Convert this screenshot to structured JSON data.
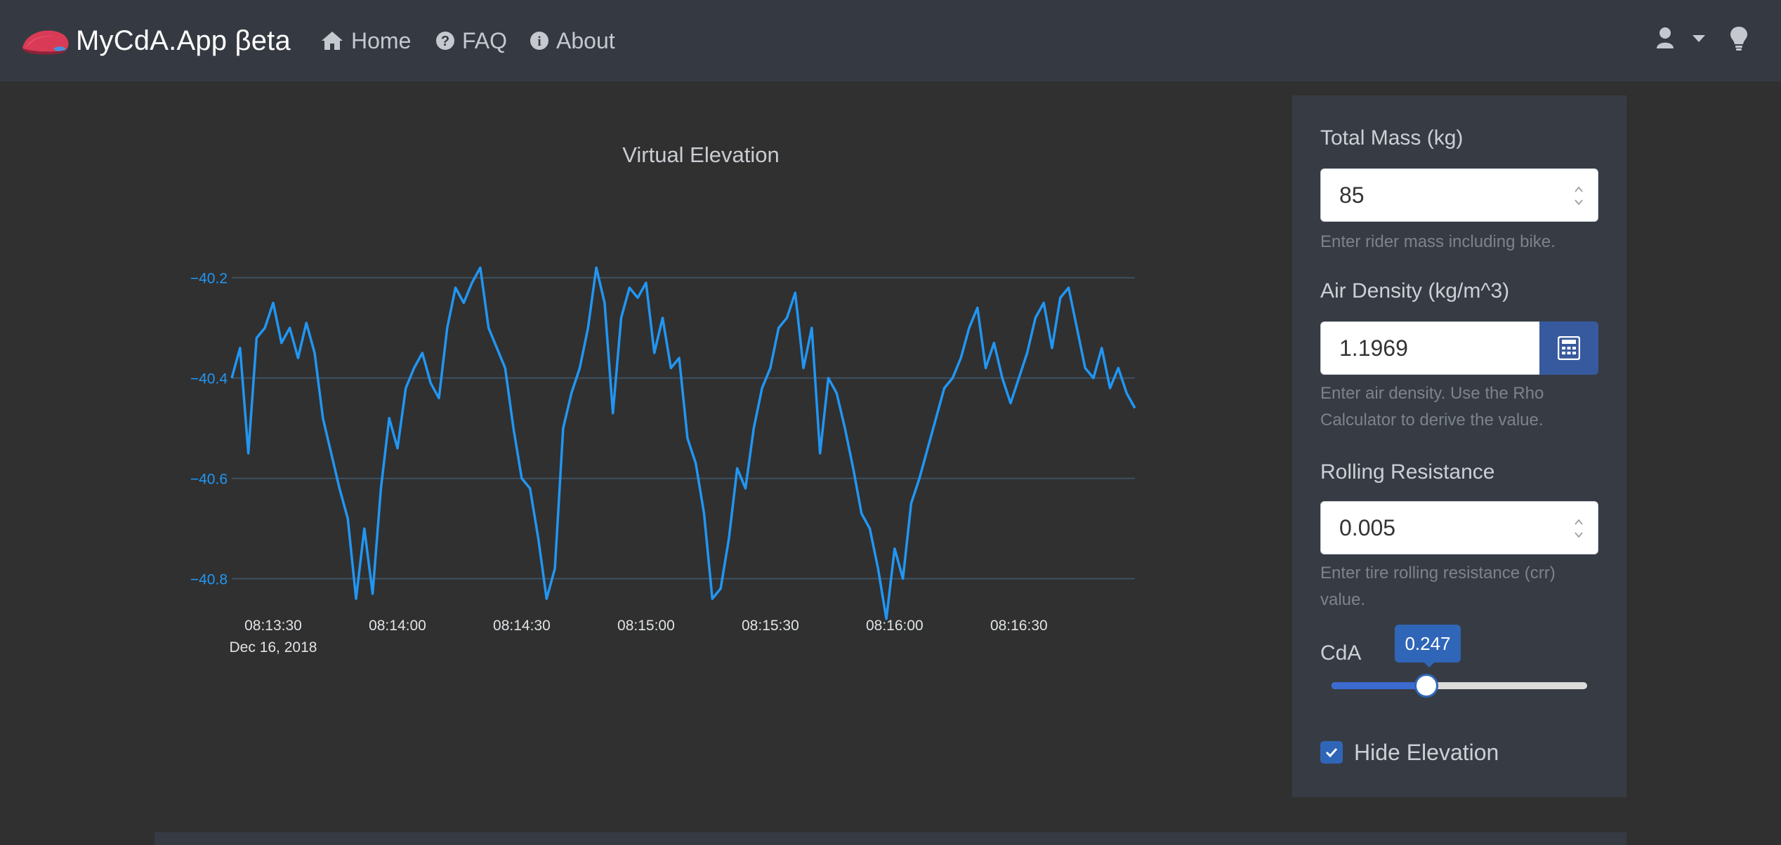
{
  "navbar": {
    "brand": "MyCdA.App βeta",
    "links": [
      {
        "label": "Home",
        "icon": "home-icon"
      },
      {
        "label": "FAQ",
        "icon": "question-circle-icon"
      },
      {
        "label": "About",
        "icon": "info-circle-icon"
      }
    ],
    "right_icons": [
      "user-icon",
      "caret-down-icon",
      "lightbulb-icon"
    ]
  },
  "sidebar": {
    "mass": {
      "label": "Total Mass (kg)",
      "value": "85",
      "help": "Enter rider mass including bike."
    },
    "density": {
      "label": "Air Density (kg/m^3)",
      "value": "1.1969",
      "help": "Enter air density. Use the Rho Calculator to derive the value.",
      "button_icon": "calculator-icon"
    },
    "crr": {
      "label": "Rolling Resistance",
      "value": "0.005",
      "help": "Enter tire rolling resistance (crr) value."
    },
    "cda": {
      "label": "CdA",
      "value": "0.247",
      "slider_fraction": 0.37
    },
    "hide_elevation": {
      "label": "Hide Elevation",
      "checked": true
    }
  },
  "colors": {
    "accent": "#2f66b8",
    "line": "#2196f3",
    "navbar": "#353a42"
  },
  "chart_data": {
    "type": "line",
    "title": "Virtual Elevation",
    "xlabel": "",
    "ylabel": "",
    "x_ticks": [
      "08:13:30",
      "08:14:00",
      "08:14:30",
      "08:15:00",
      "08:15:30",
      "08:16:00",
      "08:16:30"
    ],
    "x_tick_sublabel": "Dec 16, 2018",
    "y_ticks": [
      "−40.2",
      "−40.4",
      "−40.6",
      "−40.8"
    ],
    "ylim": [
      -40.9,
      -40.15
    ],
    "grid": true,
    "legend": "none",
    "series": [
      {
        "x": [
          "08:13:20",
          "08:13:22",
          "08:13:24",
          "08:13:26",
          "08:13:28",
          "08:13:30",
          "08:13:32",
          "08:13:34",
          "08:13:36",
          "08:13:38",
          "08:13:40",
          "08:13:42",
          "08:13:44",
          "08:13:46",
          "08:13:48",
          "08:13:50",
          "08:13:52",
          "08:13:54",
          "08:13:56",
          "08:13:58",
          "08:14:00",
          "08:14:02",
          "08:14:04",
          "08:14:06",
          "08:14:08",
          "08:14:10",
          "08:14:12",
          "08:14:14",
          "08:14:16",
          "08:14:18",
          "08:14:20",
          "08:14:22",
          "08:14:24",
          "08:14:26",
          "08:14:28",
          "08:14:30",
          "08:14:32",
          "08:14:34",
          "08:14:36",
          "08:14:38",
          "08:14:40",
          "08:14:42",
          "08:14:44",
          "08:14:46",
          "08:14:48",
          "08:14:50",
          "08:14:52",
          "08:14:54",
          "08:14:56",
          "08:14:58",
          "08:15:00",
          "08:15:02",
          "08:15:04",
          "08:15:06",
          "08:15:08",
          "08:15:10",
          "08:15:12",
          "08:15:14",
          "08:15:16",
          "08:15:18",
          "08:15:20",
          "08:15:22",
          "08:15:24",
          "08:15:26",
          "08:15:28",
          "08:15:30",
          "08:15:32",
          "08:15:34",
          "08:15:36",
          "08:15:38",
          "08:15:40",
          "08:15:42",
          "08:15:44",
          "08:15:46",
          "08:15:48",
          "08:15:50",
          "08:15:52",
          "08:15:54",
          "08:15:56",
          "08:15:58",
          "08:16:00",
          "08:16:02",
          "08:16:04",
          "08:16:06",
          "08:16:08",
          "08:16:10",
          "08:16:12",
          "08:16:14",
          "08:16:16",
          "08:16:18",
          "08:16:20",
          "08:16:22",
          "08:16:24",
          "08:16:26",
          "08:16:28",
          "08:16:30",
          "08:16:32",
          "08:16:34",
          "08:16:36",
          "08:16:38",
          "08:16:40",
          "08:16:42",
          "08:16:44",
          "08:16:46",
          "08:16:48",
          "08:16:50",
          "08:16:52",
          "08:16:54",
          "08:16:56",
          "08:16:58"
        ],
        "values": [
          -40.4,
          -40.34,
          -40.55,
          -40.32,
          -40.3,
          -40.25,
          -40.33,
          -40.3,
          -40.36,
          -40.29,
          -40.35,
          -40.48,
          -40.55,
          -40.62,
          -40.68,
          -40.84,
          -40.7,
          -40.83,
          -40.62,
          -40.48,
          -40.54,
          -40.42,
          -40.38,
          -40.35,
          -40.41,
          -40.44,
          -40.3,
          -40.22,
          -40.25,
          -40.21,
          -40.18,
          -40.3,
          -40.34,
          -40.38,
          -40.5,
          -40.6,
          -40.62,
          -40.72,
          -40.84,
          -40.78,
          -40.5,
          -40.43,
          -40.38,
          -40.3,
          -40.18,
          -40.25,
          -40.47,
          -40.28,
          -40.22,
          -40.24,
          -40.21,
          -40.35,
          -40.28,
          -40.38,
          -40.36,
          -40.52,
          -40.57,
          -40.67,
          -40.84,
          -40.82,
          -40.72,
          -40.58,
          -40.62,
          -40.5,
          -40.42,
          -40.38,
          -40.3,
          -40.28,
          -40.23,
          -40.38,
          -40.3,
          -40.55,
          -40.4,
          -40.43,
          -40.5,
          -40.58,
          -40.67,
          -40.7,
          -40.78,
          -40.88,
          -40.74,
          -40.8,
          -40.65,
          -40.6,
          -40.54,
          -40.48,
          -40.42,
          -40.4,
          -40.36,
          -40.3,
          -40.26,
          -40.38,
          -40.33,
          -40.4,
          -40.45,
          -40.4,
          -40.35,
          -40.28,
          -40.25,
          -40.34,
          -40.24,
          -40.22,
          -40.3,
          -40.38,
          -40.4,
          -40.34,
          -40.42,
          -40.38,
          -40.43,
          -40.46
        ]
      }
    ]
  }
}
